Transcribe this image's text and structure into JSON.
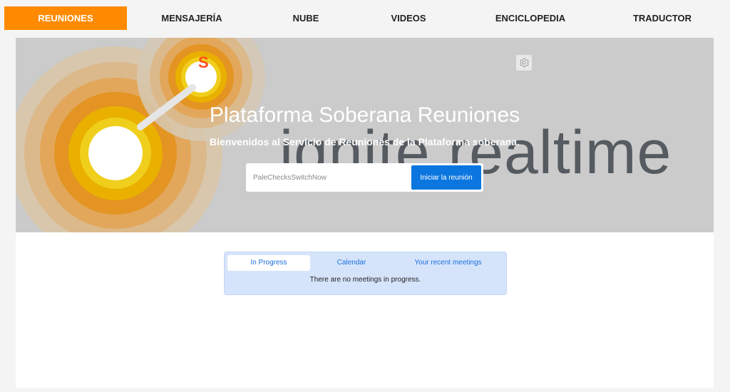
{
  "nav": {
    "items": [
      {
        "label": "REUNIONES",
        "active": true
      },
      {
        "label": "MENSAJERÍA",
        "active": false
      },
      {
        "label": "NUBE",
        "active": false
      },
      {
        "label": "VIDEOS",
        "active": false
      },
      {
        "label": "ENCICLOPEDIA",
        "active": false
      },
      {
        "label": "TRADUCTOR",
        "active": false
      }
    ]
  },
  "hero": {
    "title": "Plataforma Soberana Reuniones",
    "subtitle": "Bienvenidos al Servicio de Reuniones de la Plataforma soberana.",
    "watermark": "ignite realtime",
    "logo_letter": "S",
    "settings_icon": "gear-icon"
  },
  "join": {
    "placeholder": "PaleChecksSwitchNow",
    "value": "",
    "button_label": "Iniciar la reunión"
  },
  "meetings": {
    "tabs": [
      {
        "label": "In Progress",
        "active": true
      },
      {
        "label": "Calendar",
        "active": false
      },
      {
        "label": "Your recent meetings",
        "active": false
      }
    ],
    "message": "There are no meetings in progress."
  },
  "colors": {
    "accent": "#ff8a00",
    "primary_button": "#0b76e0",
    "tab_text": "#1a6fdc",
    "tabs_bg": "#d6e4fb",
    "hero_bg": "#cbcbcb"
  }
}
